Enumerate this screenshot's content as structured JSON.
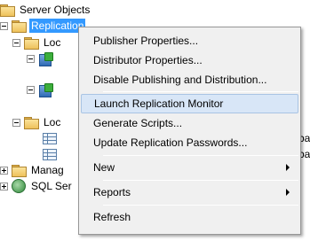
{
  "tree": {
    "server_objects": "Server Objects",
    "replication": "Replication",
    "local_publications": "Loc",
    "publication_a_suffix": "",
    "publication_b_suffix": "",
    "local_subscriptions": "Loc",
    "sub_a_suffix": "ba",
    "sub_b_suffix": "ba",
    "management": "Manag",
    "sql_agent": "SQL Ser"
  },
  "context_menu": {
    "items": [
      {
        "label": "Publisher Properties..."
      },
      {
        "label": "Distributor Properties..."
      },
      {
        "label": "Disable Publishing and Distribution..."
      },
      {
        "label": "Launch Replication Monitor"
      },
      {
        "label": "Generate Scripts..."
      },
      {
        "label": "Update Replication Passwords..."
      },
      {
        "label": "New"
      },
      {
        "label": "Reports"
      },
      {
        "label": "Refresh"
      }
    ],
    "highlighted": "Launch Replication Monitor"
  },
  "colors": {
    "selection": "#3399ff",
    "menu_hover": "#d8e6f7",
    "menu_background": "#f0f0f0"
  }
}
